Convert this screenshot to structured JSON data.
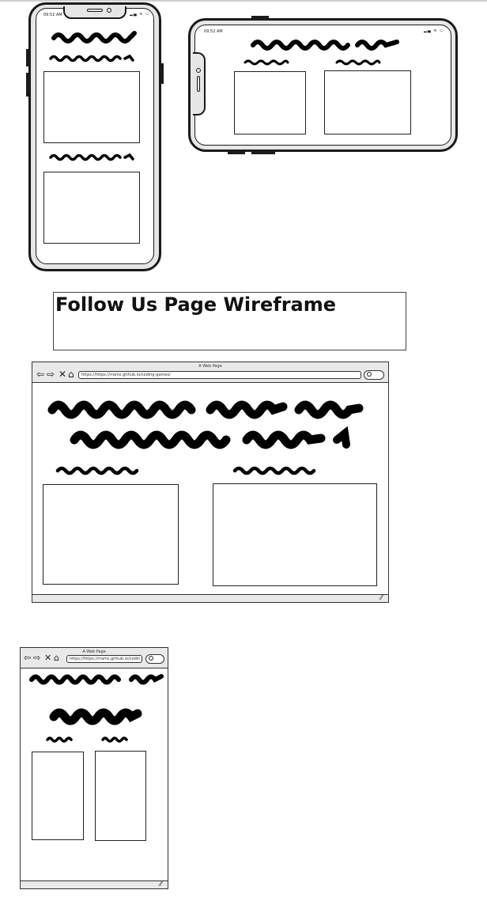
{
  "wireframe": {
    "title": "Follow Us Page Wireframe"
  },
  "mobile_portrait": {
    "status_time": "09:52 AM",
    "status_icons": "▂▄ ≋ ▭"
  },
  "mobile_landscape": {
    "status_time": "09:52 AM",
    "status_icons": "▂▄ ≋ ▭"
  },
  "desktop_browser": {
    "window_title": "A Web Page",
    "url": "https://https://rrams.github.io/coding-games/"
  },
  "tablet_browser": {
    "window_title": "A Web Page",
    "url": "https://https://rrams.github.io/codin"
  },
  "icons": {
    "back": "back-arrow-icon",
    "forward": "forward-arrow-icon",
    "stop": "close-icon",
    "home": "home-icon",
    "search": "search-icon",
    "resize": "resize-grip-icon"
  }
}
